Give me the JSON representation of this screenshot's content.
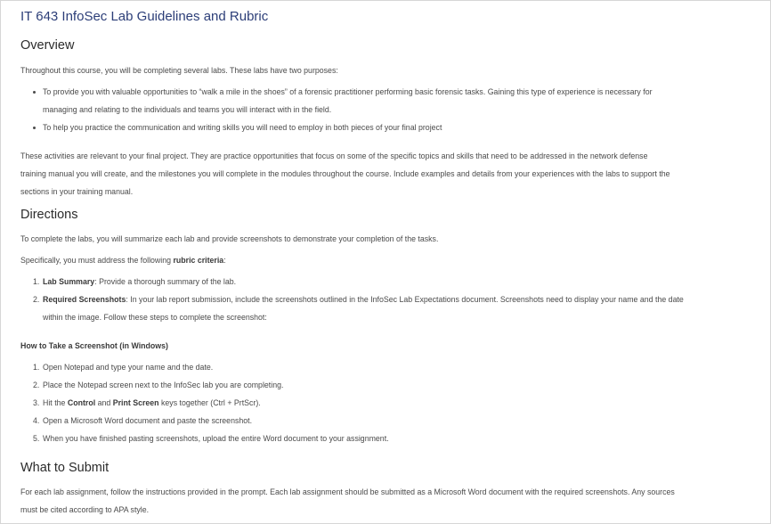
{
  "title": "IT 643 InfoSec Lab Guidelines and Rubric",
  "overview": {
    "heading": "Overview",
    "intro": "Throughout this course, you will be completing several labs. These labs have two purposes:",
    "bullets": [
      {
        "line1": "To provide you with valuable opportunities to “walk a mile in the shoes” of a forensic practitioner performing basic forensic tasks. Gaining this type of experience is necessary for",
        "line2": "managing and relating to the individuals and teams you will interact with in the field."
      },
      {
        "line1": "To help you practice the communication and writing skills you will need to employ in both pieces of your final project",
        "line2": ""
      }
    ],
    "paragraph_lines": [
      "These activities are relevant to your final project. They are practice opportunities that focus on some of the specific topics and skills that need to be addressed in the network defense",
      "training manual you will create, and the milestones you will complete in the modules throughout the course. Include examples and details from your experiences with the labs to support the",
      "sections in your training manual."
    ]
  },
  "directions": {
    "heading": "Directions",
    "p1": "To complete the labs, you will summarize each lab and provide screenshots to demonstrate your completion of the tasks.",
    "p2_prefix": "Specifically, you must address the following ",
    "p2_bold": "rubric criteria",
    "p2_suffix": ":",
    "criteria": [
      {
        "num": "1.",
        "bold": "Lab Summary",
        "line1": ": Provide a thorough summary of the lab.",
        "line2": ""
      },
      {
        "num": "2.",
        "bold": "Required Screenshots",
        "line1": ": In your lab report submission, include the screenshots outlined in the InfoSec Lab Expectations document. Screenshots need to display your name and the date",
        "line2": "within the image. Follow these steps to complete the screenshot:"
      }
    ],
    "how_to_heading": "How to Take a Screenshot (in Windows)",
    "steps": [
      {
        "num": "1.",
        "text": "Open Notepad and type your name and the date."
      },
      {
        "num": "2.",
        "text": "Place the Notepad screen next to the InfoSec lab you are completing."
      },
      {
        "num": "3.",
        "pre": "Hit the ",
        "b1": "Control",
        "mid": " and ",
        "b2": "Print Screen",
        "post": " keys together (Ctrl + PrtScr)."
      },
      {
        "num": "4.",
        "text": "Open a Microsoft Word document and paste the screenshot."
      },
      {
        "num": "5.",
        "text": "When you have finished pasting screenshots, upload the entire Word document to your assignment."
      }
    ]
  },
  "submit": {
    "heading": "What to Submit",
    "lines": [
      "For each lab assignment, follow the instructions provided in the prompt. Each lab assignment should be submitted as a Microsoft Word document with the required screenshots. Any sources",
      "must be cited according to APA style."
    ]
  }
}
